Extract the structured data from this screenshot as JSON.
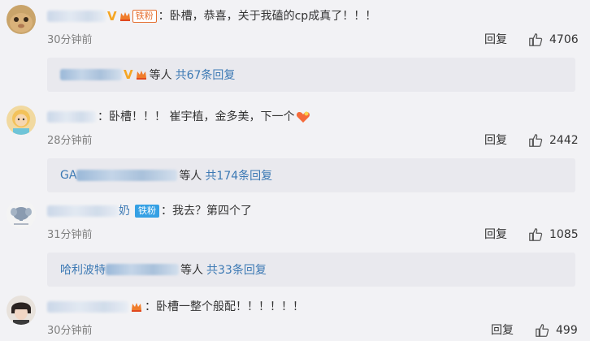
{
  "comments": [
    {
      "name_visible": "",
      "text": "卧槽，恭喜，关于我磕的cp成真了！！！",
      "fan_tag": "铁粉",
      "time": "30分钟前",
      "reply_label": "回复",
      "likes": "4706",
      "subreply": {
        "name_visible": "",
        "dengren": "等人",
        "total": "共67条回复"
      }
    },
    {
      "name_visible": "",
      "text": "卧槽！！！ 崔宇植，金多美，下一个",
      "time": "28分钟前",
      "reply_label": "回复",
      "likes": "2442",
      "subreply": {
        "name_visible": "GA",
        "dengren": "等人",
        "total": "共174条回复"
      }
    },
    {
      "name_visible": "奶",
      "text": "我去？第四个了",
      "fan_tag": "铁粉",
      "time": "31分钟前",
      "reply_label": "回复",
      "likes": "1085",
      "subreply": {
        "name_visible": "哈利波特",
        "dengren": "等人",
        "total": "共33条回复"
      }
    },
    {
      "name_visible": "",
      "text": "卧槽一整个般配！！！！！！",
      "time": "30分钟前",
      "reply_label": "回复",
      "likes": "499"
    }
  ],
  "colors": {
    "background": "#f2f2f5",
    "link_blue": "#3c79b4",
    "badge_gold": "#f5a623",
    "name_orange": "#eb7350"
  }
}
